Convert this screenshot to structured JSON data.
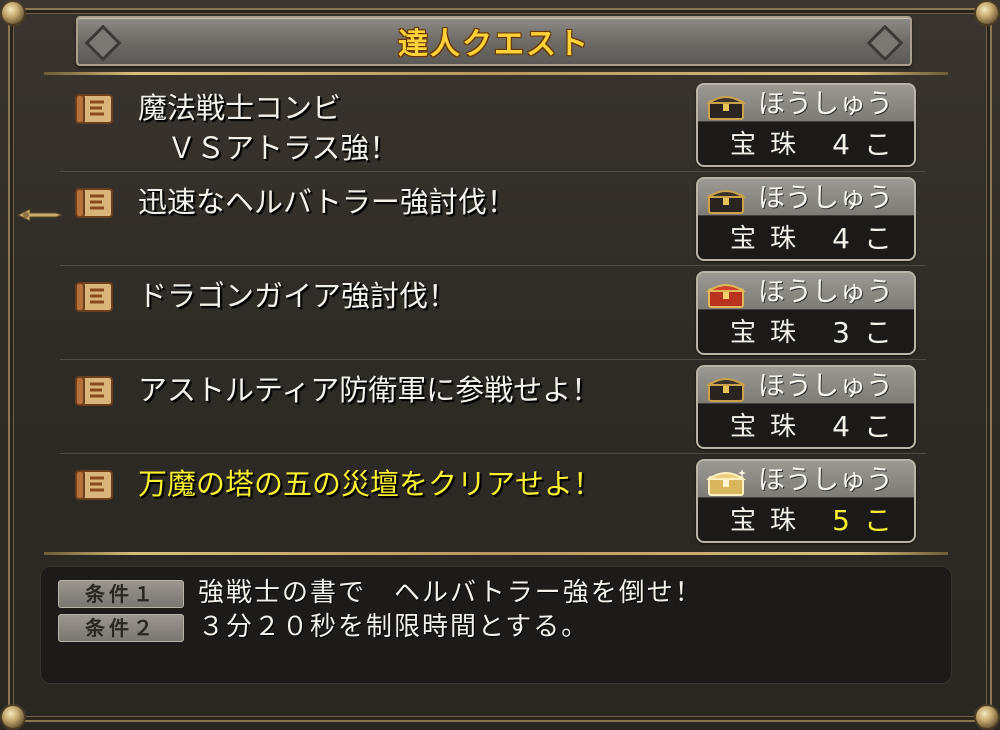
{
  "header": {
    "title": "達人クエスト"
  },
  "quests": [
    {
      "title": "魔法戦士コンビ\n　ＶＳアトラス強！",
      "reward_label": "ほうしゅう",
      "reward_item": "宝珠",
      "reward_count": "4こ",
      "chest": "black-chest-icon",
      "highlight": false
    },
    {
      "title": "迅速なヘルバトラー強討伐！",
      "reward_label": "ほうしゅう",
      "reward_item": "宝珠",
      "reward_count": "4こ",
      "chest": "black-chest-icon",
      "highlight": false
    },
    {
      "title": "ドラゴンガイア強討伐！",
      "reward_label": "ほうしゅう",
      "reward_item": "宝珠",
      "reward_count": "3こ",
      "chest": "red-chest-icon",
      "highlight": false
    },
    {
      "title": "アストルティア防衛軍に参戦せよ！",
      "reward_label": "ほうしゅう",
      "reward_item": "宝珠",
      "reward_count": "4こ",
      "chest": "black-chest-icon",
      "highlight": false
    },
    {
      "title": "万魔の塔の五の災壇をクリアせよ！",
      "reward_label": "ほうしゅう",
      "reward_item": "宝珠",
      "reward_count": "5こ",
      "chest": "gold-chest-icon",
      "highlight": true
    }
  ],
  "conditions": [
    {
      "badge": "条件１",
      "text": "強戦士の書で　ヘルバトラー強を倒せ！"
    },
    {
      "badge": "条件２",
      "text": "３分２０秒を制限時間とする。"
    }
  ],
  "colors": {
    "highlight": "#f8f030",
    "title_gold": "#ffd23a",
    "text": "#f4f1ea",
    "background": "#2e2a25"
  }
}
